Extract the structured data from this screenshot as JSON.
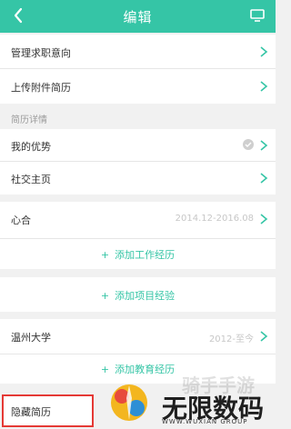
{
  "header": {
    "title": "编辑",
    "back_icon": "back-chevron-icon",
    "screen_icon": "screen-icon"
  },
  "rows": {
    "intention": "管理求职意向",
    "upload": "上传附件简历",
    "section_resume": "简历详情",
    "advantage": "我的优势",
    "social": "社交主页",
    "work_company": "心合",
    "work_period": "2014.12-2016.08",
    "add_work": "添加工作经历",
    "add_project": "添加项目经验",
    "school": "温州大学",
    "school_period": "2012-至今",
    "add_education": "添加教育经历",
    "hide": "隐藏简历"
  },
  "watermark": {
    "brand": "无限数码",
    "brand_sub": "WWW.WUXIAN GROUP",
    "tag": "骑手手游"
  },
  "colors": {
    "accent": "#35c5a6",
    "highlight": "#e53935"
  }
}
